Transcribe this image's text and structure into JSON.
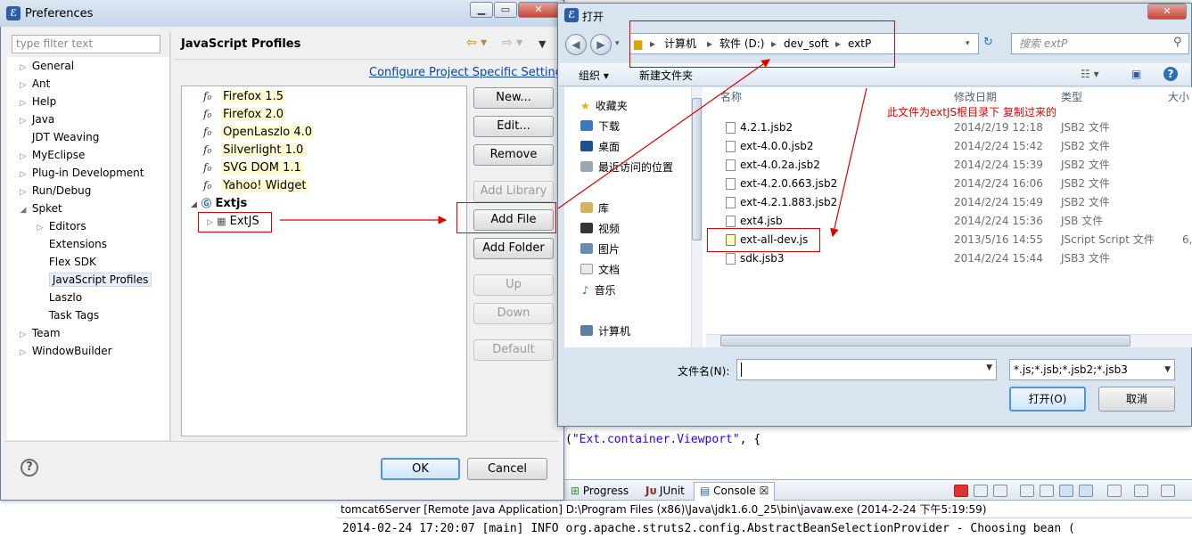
{
  "preferences": {
    "title": "Preferences",
    "filter_placeholder": "type filter text",
    "tree": [
      {
        "label": "General",
        "arrow": "▷"
      },
      {
        "label": "Ant",
        "arrow": "▷"
      },
      {
        "label": "Help",
        "arrow": "▷"
      },
      {
        "label": "Java",
        "arrow": "▷"
      },
      {
        "label": "JDT Weaving",
        "arrow": ""
      },
      {
        "label": "MyEclipse",
        "arrow": "▷"
      },
      {
        "label": "Plug-in Development",
        "arrow": "▷"
      },
      {
        "label": "Run/Debug",
        "arrow": "▷"
      },
      {
        "label": "Spket",
        "arrow": "◢"
      },
      {
        "label": "Editors",
        "arrow": "▷"
      },
      {
        "label": "Extensions",
        "arrow": ""
      },
      {
        "label": "Flex SDK",
        "arrow": ""
      },
      {
        "label": "JavaScript Profiles",
        "arrow": ""
      },
      {
        "label": "Laszlo",
        "arrow": ""
      },
      {
        "label": "Task Tags",
        "arrow": ""
      },
      {
        "label": "Team",
        "arrow": "▷"
      },
      {
        "label": "WindowBuilder",
        "arrow": "▷"
      }
    ],
    "page_title": "JavaScript Profiles",
    "configure_link": "Configure Project Specific Settings...",
    "libraries": [
      "Firefox 1.5",
      "Firefox 2.0",
      "OpenLaszlo 4.0",
      "Silverlight 1.0",
      "SVG DOM 1.1",
      "Yahoo! Widget"
    ],
    "profile": "Extjs",
    "profile_child": "ExtJS",
    "buttons": {
      "new": "New...",
      "edit": "Edit...",
      "remove": "Remove",
      "add_library": "Add Library",
      "add_file": "Add File",
      "add_folder": "Add Folder",
      "up": "Up",
      "down": "Down",
      "default": "Default",
      "ok": "OK",
      "cancel": "Cancel"
    }
  },
  "open_dialog": {
    "title": "打开",
    "path": [
      "计算机",
      "软件 (D:)",
      "dev_soft",
      "extP"
    ],
    "search_placeholder": "搜索 extP",
    "toolbar": {
      "organize": "组织 ▾",
      "new_folder": "新建文件夹"
    },
    "nav": {
      "favorites": "收藏夹",
      "downloads": "下载",
      "desktop": "桌面",
      "recent": "最近访问的位置",
      "libraries": "库",
      "videos": "视频",
      "pictures": "图片",
      "documents": "文档",
      "music": "音乐",
      "computer": "计算机"
    },
    "columns": {
      "name": "名称",
      "date": "修改日期",
      "type": "类型",
      "size": "大小"
    },
    "files": [
      {
        "name": "4.2.1.jsb2",
        "date": "2014/2/19 12:18",
        "type": "JSB2 文件",
        "size": ""
      },
      {
        "name": "ext-4.0.0.jsb2",
        "date": "2014/2/24 15:42",
        "type": "JSB2 文件",
        "size": ""
      },
      {
        "name": "ext-4.0.2a.jsb2",
        "date": "2014/2/24 15:39",
        "type": "JSB2 文件",
        "size": ""
      },
      {
        "name": "ext-4.2.0.663.jsb2",
        "date": "2014/2/24 16:06",
        "type": "JSB2 文件",
        "size": ""
      },
      {
        "name": "ext-4.2.1.883.jsb2",
        "date": "2014/2/24 15:49",
        "type": "JSB2 文件",
        "size": ""
      },
      {
        "name": "ext4.jsb",
        "date": "2014/2/24 15:36",
        "type": "JSB 文件",
        "size": ""
      },
      {
        "name": "ext-all-dev.js",
        "date": "2013/5/16 14:55",
        "type": "JScript Script 文件",
        "size": "6,"
      },
      {
        "name": "sdk.jsb3",
        "date": "2014/2/24 15:44",
        "type": "JSB3 文件",
        "size": ""
      }
    ],
    "filename_label": "文件名(N):",
    "filename_value": "",
    "filetype": "*.js;*.jsb;*.jsb2;*.jsb3",
    "open_button": "打开(O)",
    "cancel_button": "取消"
  },
  "annotation": "此文件为extJS根目录下 复制过来的",
  "editor": {
    "code_prefix": "(",
    "code_string": "\"Ext.container.Viewport\"",
    "code_suffix": ", {"
  },
  "console": {
    "tabs": [
      "Progress",
      "JUnit",
      "Console ☒"
    ],
    "header": "tomcat6Server [Remote Java Application] D:\\Program Files (x86)\\Java\\jdk1.6.0_25\\bin\\javaw.exe (2014-2-24 下午5:19:59)",
    "line": "2014-02-24 17:20:07 [main] INFO  org.apache.struts2.config.AbstractBeanSelectionProvider - Choosing bean ("
  }
}
